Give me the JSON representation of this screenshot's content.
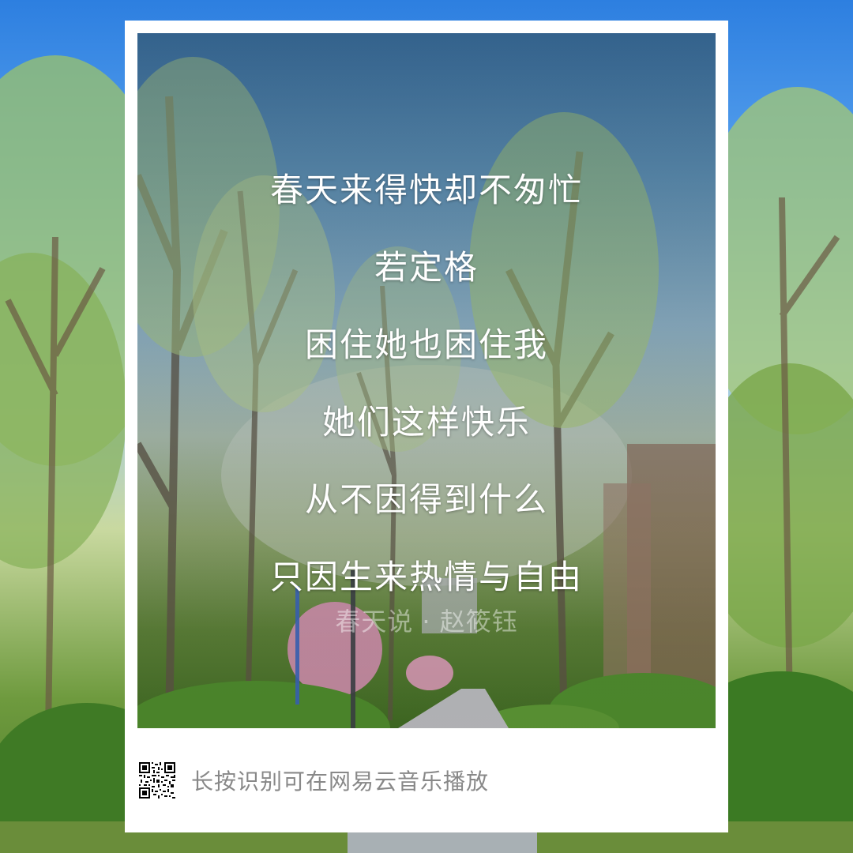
{
  "lyrics": {
    "lines": [
      "春天来得快却不匆忙",
      "若定格",
      "困住她也困住我",
      "她们这样快乐",
      "从不因得到什么",
      "只因生来热情与自由"
    ],
    "credit": "春天说 · 赵筱钰"
  },
  "footer": {
    "qr_icon": "qr-code-icon",
    "text": "长按识别可在网易云音乐播放"
  },
  "colors": {
    "card": "#ffffff",
    "lyric_text": "#ffffff",
    "footer_text": "#888888"
  }
}
